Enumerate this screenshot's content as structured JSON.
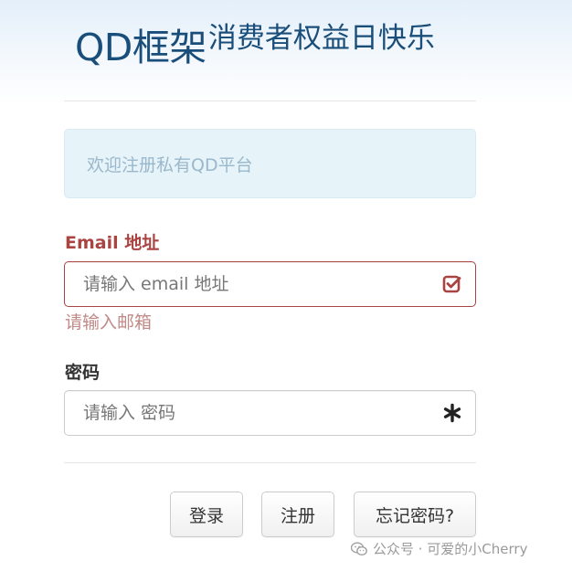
{
  "header": {
    "brand": "QD框架",
    "tagline": "消费者权益日快乐"
  },
  "alert": {
    "message": "欢迎注册私有QD平台"
  },
  "email": {
    "label": "Email 地址",
    "placeholder": "请输入 email 地址",
    "value": "",
    "help": "请输入邮箱",
    "status_icon": "check-square-icon",
    "status_color": "#a94442"
  },
  "password": {
    "label": "密码",
    "placeholder": "请输入 密码",
    "value": "",
    "status_icon": "asterisk-icon"
  },
  "buttons": {
    "login": "登录",
    "register": "注册",
    "forgot": "忘记密码?"
  },
  "watermark": {
    "text": "公众号 · 可爱的小Cherry",
    "icon": "wechat-icon"
  },
  "colors": {
    "brand": "#1a4e7a",
    "error": "#a94442",
    "alert_bg": "#e6f3f9",
    "alert_text": "#9ab8cc"
  }
}
